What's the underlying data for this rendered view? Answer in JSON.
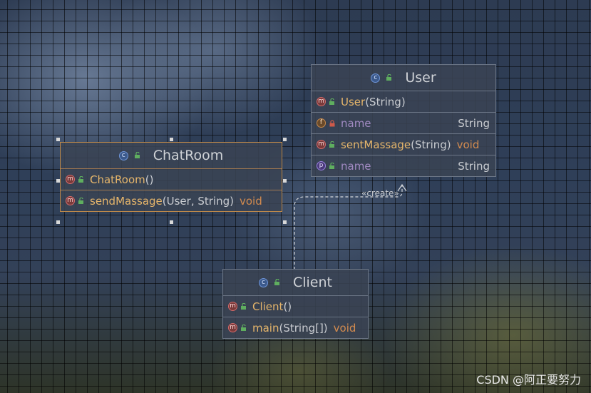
{
  "diagram": {
    "classes": {
      "user": {
        "name": "User",
        "kind_icon": "class-icon",
        "members": [
          {
            "icon": "method-icon",
            "access": "public",
            "name": "User",
            "params": "(String)",
            "return_type": ""
          },
          {
            "icon": "field-icon",
            "access": "private",
            "name": "name",
            "params": "",
            "return_type": "String"
          },
          {
            "icon": "method-icon",
            "access": "public",
            "name": "sentMassage",
            "params": "(String)",
            "return_type": "void"
          },
          {
            "icon": "property-icon",
            "access": "public",
            "name": "name",
            "params": "",
            "return_type": "String"
          }
        ]
      },
      "chatroom": {
        "name": "ChatRoom",
        "kind_icon": "class-icon",
        "selected": true,
        "members": [
          {
            "icon": "method-icon",
            "access": "public",
            "name": "ChatRoom",
            "params": "()",
            "return_type": ""
          },
          {
            "icon": "method-icon",
            "access": "public",
            "name": "sendMassage",
            "params": "(User, String)",
            "return_type": "void"
          }
        ]
      },
      "client": {
        "name": "Client",
        "kind_icon": "class-icon",
        "members": [
          {
            "icon": "method-icon",
            "access": "public",
            "name": "Client",
            "params": "()",
            "return_type": ""
          },
          {
            "icon": "method-icon",
            "access": "public",
            "name": "main",
            "params": "(String[])",
            "return_type": "void"
          }
        ]
      }
    },
    "relations": [
      {
        "from": "Client",
        "to": "User",
        "style": "dashed",
        "label": "«create»"
      }
    ],
    "colors": {
      "method_name": "#e5b56b",
      "field_name": "#a18ac2",
      "return_type_void": "#d38b4f",
      "selection_border": "#c08a4a"
    }
  },
  "watermark": "CSDN @阿正要努力"
}
